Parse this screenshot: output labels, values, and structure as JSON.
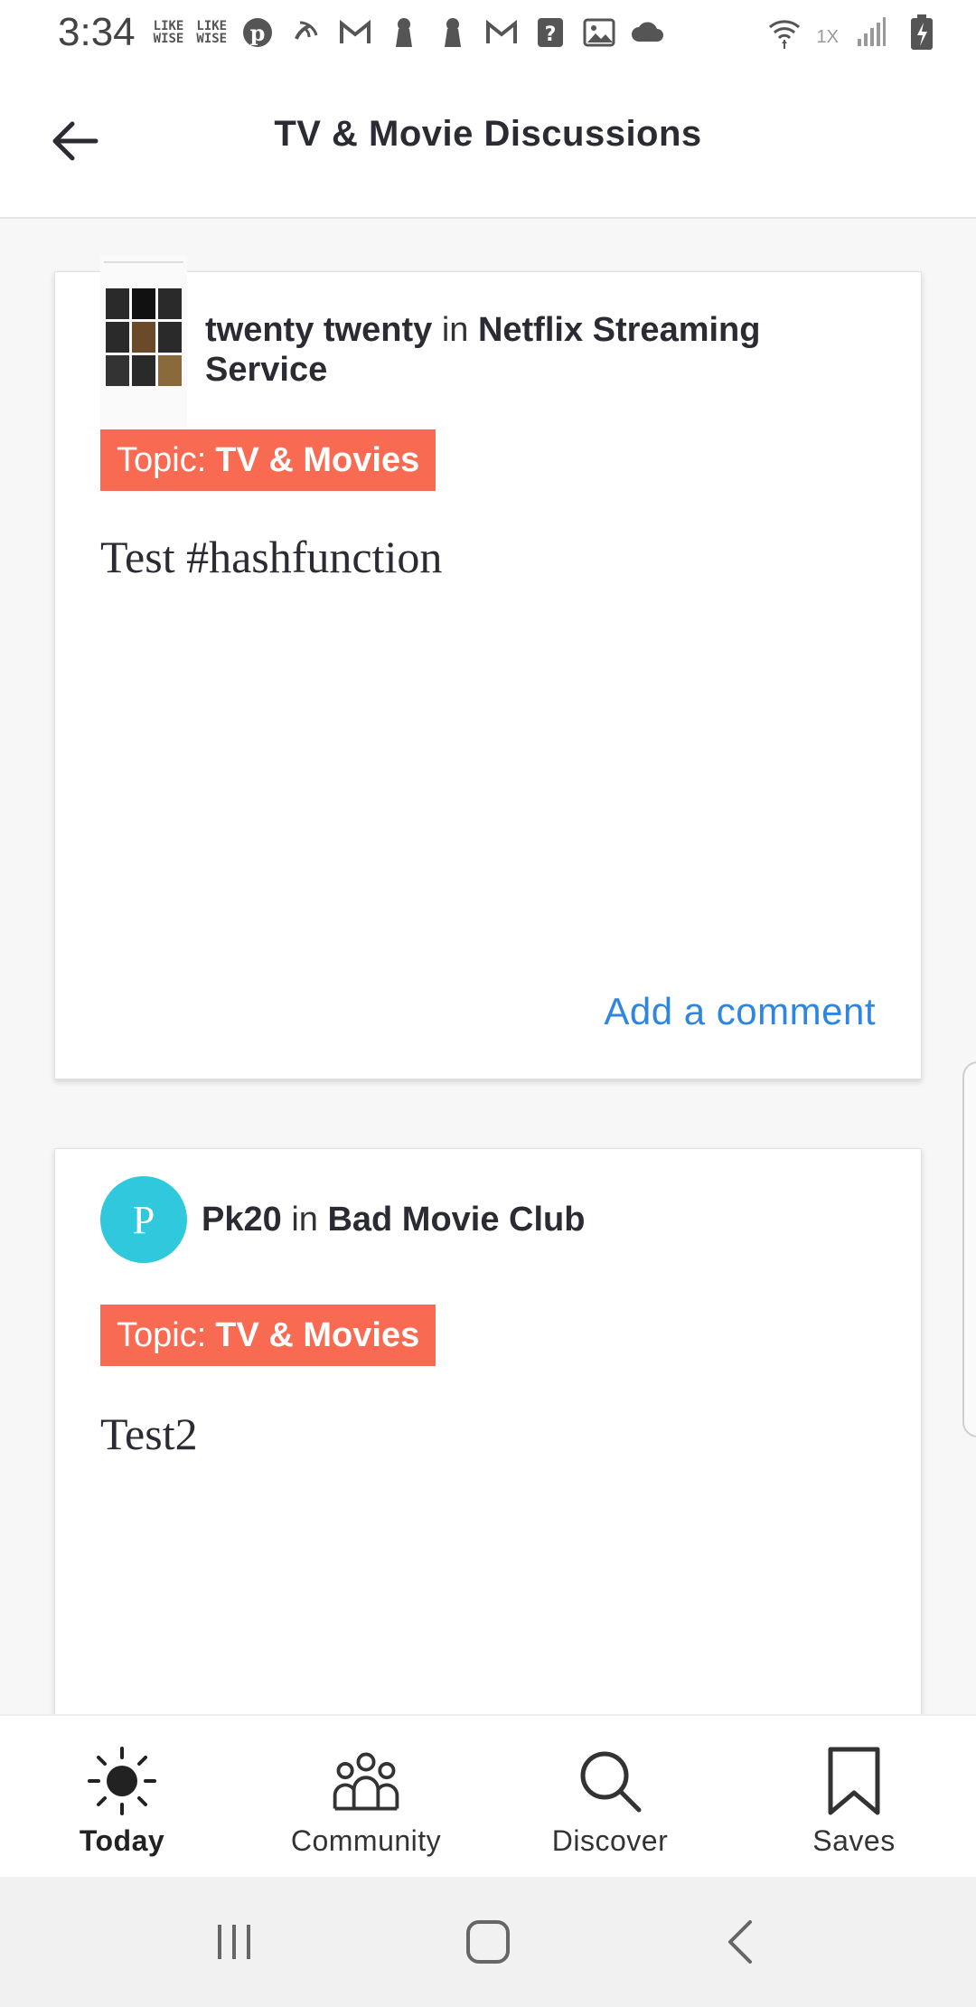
{
  "status_bar": {
    "time": "3:34",
    "left_icons": [
      "like-wise-icon",
      "like-wise-icon",
      "pinterest-icon",
      "wifi-call-icon",
      "gmail-icon",
      "keyhole-icon",
      "keyhole-icon",
      "gmail-icon",
      "question-icon",
      "image-icon",
      "cloud-icon"
    ],
    "like_wise_line1": "LIKE",
    "like_wise_line2": "WISE",
    "speed_label": "1X",
    "right_icons": [
      "wifi-icon",
      "signal-icon",
      "battery-charging-icon"
    ]
  },
  "header": {
    "title": "TV & Movie Discussions",
    "back_icon": "arrow-left-icon"
  },
  "posts": [
    {
      "author": "twenty twenty",
      "in_word": "in",
      "community": "Netflix Streaming Service",
      "avatar_type": "screenshot-thumbnail",
      "topic_prefix": "Topic:",
      "topic": "TV & Movies",
      "body": "Test #hashfunction",
      "comment_label": "Add a comment"
    },
    {
      "author": "Pk20",
      "in_word": "in",
      "community": "Bad Movie Club",
      "avatar_letter": "P",
      "avatar_color": "#2fc8dd",
      "topic_prefix": "Topic:",
      "topic": "TV & Movies",
      "body": "Test2"
    }
  ],
  "bottom_nav": {
    "items": [
      {
        "label": "Today",
        "icon": "sun-icon",
        "active": true
      },
      {
        "label": "Community",
        "icon": "people-icon",
        "active": false
      },
      {
        "label": "Discover",
        "icon": "search-icon",
        "active": false
      },
      {
        "label": "Saves",
        "icon": "bookmark-icon",
        "active": false
      }
    ]
  },
  "system_nav": {
    "buttons": [
      "recent-apps-icon",
      "home-icon",
      "back-chevron-icon"
    ]
  },
  "colors": {
    "topic_tag": "#f86b52",
    "link": "#2f86e0",
    "avatar": "#2fc8dd",
    "title": "#2b2b33"
  }
}
